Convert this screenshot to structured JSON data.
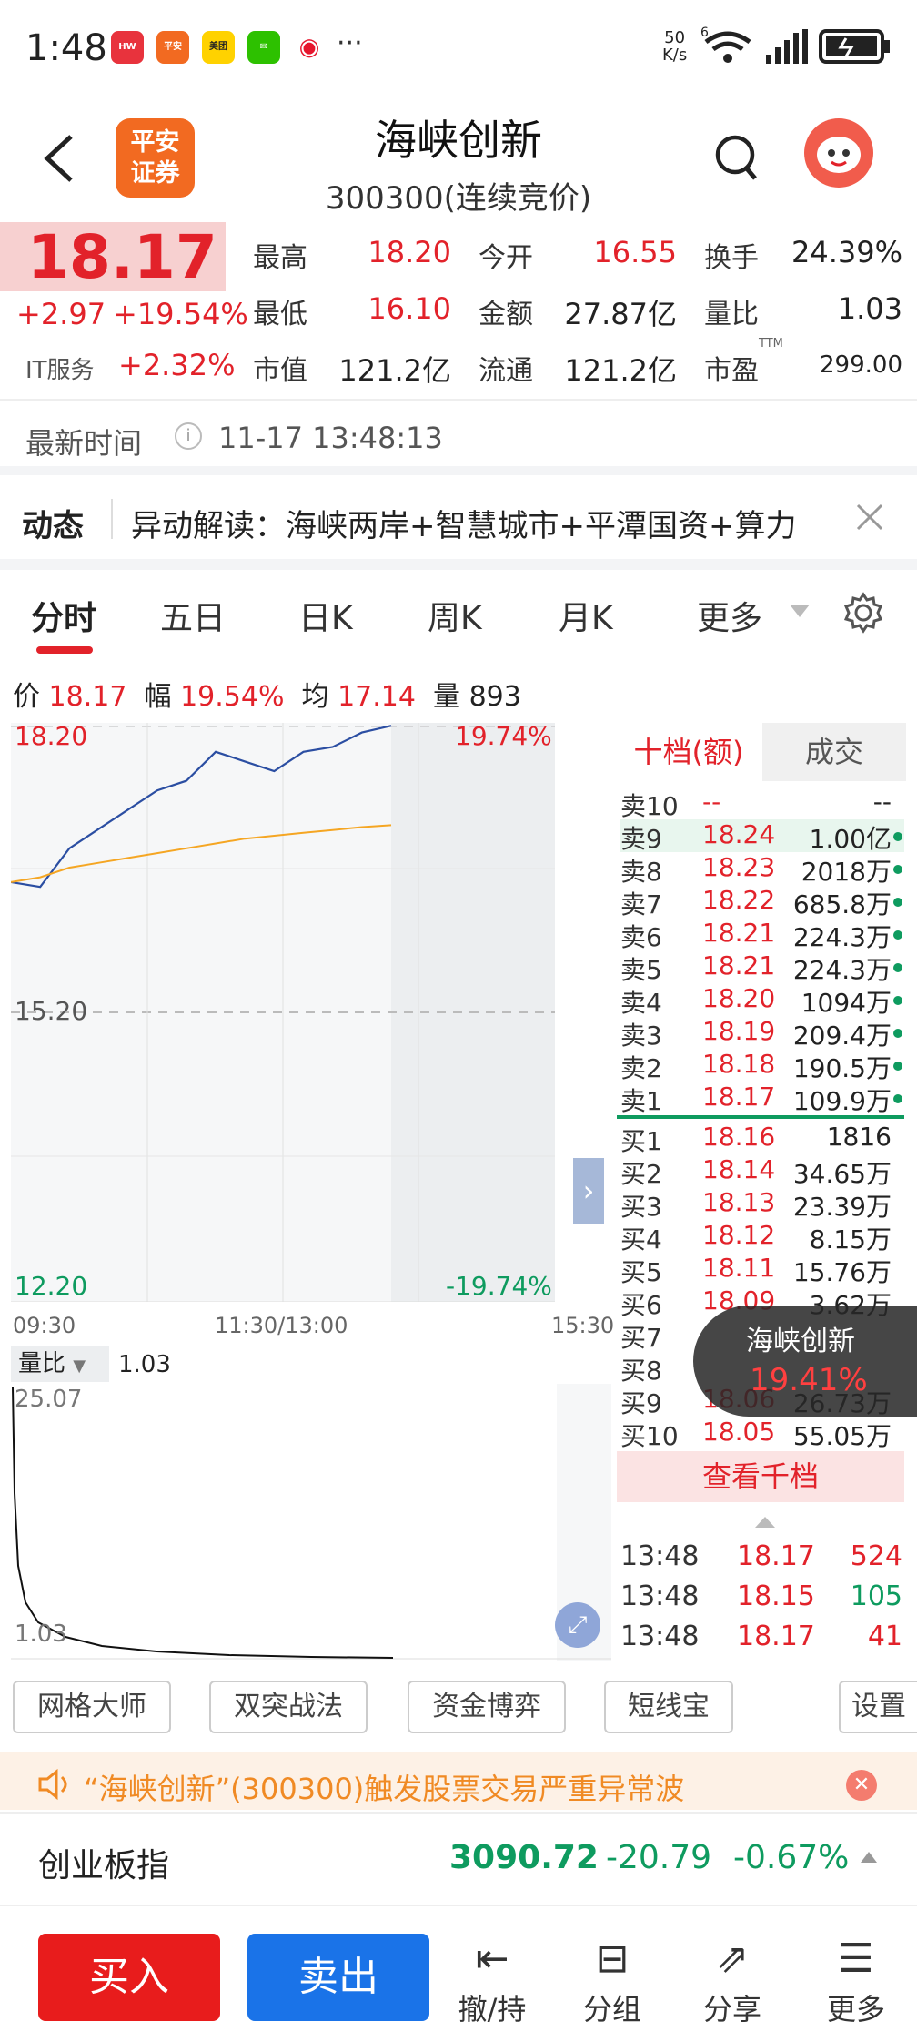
{
  "status": {
    "time": "1:48",
    "dots": "···",
    "speed_top": "50",
    "speed_bottom": "K/s",
    "signal": "6"
  },
  "header": {
    "title": "海峡创新",
    "subtitle": "300300(连续竞价)",
    "logo_line1": "平安",
    "logo_line2": "证券"
  },
  "quote": {
    "price": "18.17",
    "change": "+2.97",
    "change_pct": "+19.54%",
    "sector": "IT服务",
    "sector_pct": "+2.32%",
    "high_label": "最高",
    "high": "18.20",
    "open_label": "今开",
    "open": "16.55",
    "turnover_label": "换手",
    "turnover": "24.39%",
    "low_label": "最低",
    "low": "16.10",
    "amount_label": "金额",
    "amount": "27.87亿",
    "volratio_label": "量比",
    "volratio": "1.03",
    "mcap_label": "市值",
    "mcap": "121.2亿",
    "float_label": "流通",
    "float": "121.2亿",
    "pe_label": "市盈",
    "pe_sup": "TTM",
    "pe": "299.00"
  },
  "update": {
    "label": "最新时间",
    "time": "11-17 13:48:13"
  },
  "news": {
    "label": "动态",
    "text": "异动解读：海峡两岸+智慧城市+平潭国资+算力"
  },
  "tabs": [
    {
      "label": "分时"
    },
    {
      "label": "五日"
    },
    {
      "label": "日K"
    },
    {
      "label": "周K"
    },
    {
      "label": "月K"
    },
    {
      "label": "更多"
    }
  ],
  "chartinfo": {
    "price_label": "价",
    "price": "18.17",
    "pct_label": "幅",
    "pct": "19.54%",
    "avg_label": "均",
    "avg": "17.14",
    "vol_label": "量",
    "vol": "893"
  },
  "chart": {
    "top_price": "18.20",
    "top_pct": "19.74%",
    "mid_price": "15.20",
    "bottom_price": "12.20",
    "bottom_pct": "-19.74%",
    "t_start": "09:30",
    "t_mid": "11:30/13:00",
    "t_end": "15:30",
    "vr_label": "量比",
    "vr_value": "1.03",
    "vr_max": "25.07",
    "vr_min": "1.03"
  },
  "chart_data": {
    "type": "line",
    "x": [
      "09:30",
      "09:45",
      "10:00",
      "10:15",
      "10:30",
      "10:45",
      "11:00",
      "11:15",
      "11:30",
      "13:00",
      "13:15",
      "13:30",
      "13:45",
      "13:48"
    ],
    "ylim": [
      12.2,
      18.2
    ],
    "series": [
      {
        "values": [
          16.55,
          16.5,
          16.9,
          17.1,
          17.3,
          17.5,
          17.6,
          17.9,
          17.8,
          17.7,
          17.9,
          17.95,
          18.1,
          18.17
        ]
      },
      {
        "values": [
          16.55,
          16.6,
          16.7,
          16.75,
          16.8,
          16.85,
          16.9,
          16.95,
          17.0,
          17.03,
          17.06,
          17.09,
          17.12,
          17.14
        ]
      }
    ]
  },
  "orderbook": {
    "tab1": "十档(额)",
    "tab2": "成交",
    "sells": [
      {
        "label": "卖10",
        "price": "--",
        "amount": "--"
      },
      {
        "label": "卖9",
        "price": "18.24",
        "amount": "1.00亿"
      },
      {
        "label": "卖8",
        "price": "18.23",
        "amount": "2018万"
      },
      {
        "label": "卖7",
        "price": "18.22",
        "amount": "685.8万"
      },
      {
        "label": "卖6",
        "price": "18.21",
        "amount": "224.3万"
      },
      {
        "label": "卖5",
        "price": "18.21",
        "amount": "224.3万"
      },
      {
        "label": "卖4",
        "price": "18.20",
        "amount": "1094万"
      },
      {
        "label": "卖3",
        "price": "18.19",
        "amount": "209.4万"
      },
      {
        "label": "卖2",
        "price": "18.18",
        "amount": "190.5万"
      },
      {
        "label": "卖1",
        "price": "18.17",
        "amount": "109.9万"
      }
    ],
    "buys": [
      {
        "label": "买1",
        "price": "18.16",
        "amount": "1816"
      },
      {
        "label": "买2",
        "price": "18.14",
        "amount": "34.65万"
      },
      {
        "label": "买3",
        "price": "18.13",
        "amount": "23.39万"
      },
      {
        "label": "买4",
        "price": "18.12",
        "amount": "8.15万"
      },
      {
        "label": "买5",
        "price": "18.11",
        "amount": "15.76万"
      },
      {
        "label": "买6",
        "price": "18.09",
        "amount": "3.62万"
      },
      {
        "label": "买7",
        "price": "",
        "amount": ""
      },
      {
        "label": "买8",
        "price": "",
        "amount": ""
      },
      {
        "label": "买9",
        "price": "18.06",
        "amount": "26.73万"
      },
      {
        "label": "买10",
        "price": "18.05",
        "amount": "55.05万"
      }
    ],
    "view_more": "查看千档",
    "trades": [
      {
        "time": "13:48",
        "price": "18.17",
        "vol": "524"
      },
      {
        "time": "13:48",
        "price": "18.15",
        "vol": "105"
      },
      {
        "time": "13:48",
        "price": "18.17",
        "vol": "41"
      }
    ]
  },
  "floating": {
    "name": "海峡创新",
    "pct": "19.41%"
  },
  "tools": [
    {
      "label": "网格大师"
    },
    {
      "label": "双突战法"
    },
    {
      "label": "资金博弈"
    },
    {
      "label": "短线宝"
    },
    {
      "label": "设置"
    }
  ],
  "notice": {
    "text": "“海峡创新”(300300)触发股票交易严重异常波"
  },
  "index": {
    "name": "创业板指",
    "value": "3090.72",
    "change": "-20.79",
    "pct": "-0.67%"
  },
  "bottom": {
    "buy": "买入",
    "sell": "卖出",
    "cancel": "撤/持",
    "group": "分组",
    "share": "分享",
    "more": "更多"
  },
  "colors": {
    "up": "#e2222a",
    "down": "#0e9b5f",
    "brand": "#f26a21",
    "buy_btn": "#e81c1c",
    "sell_btn": "#1a73e8"
  }
}
